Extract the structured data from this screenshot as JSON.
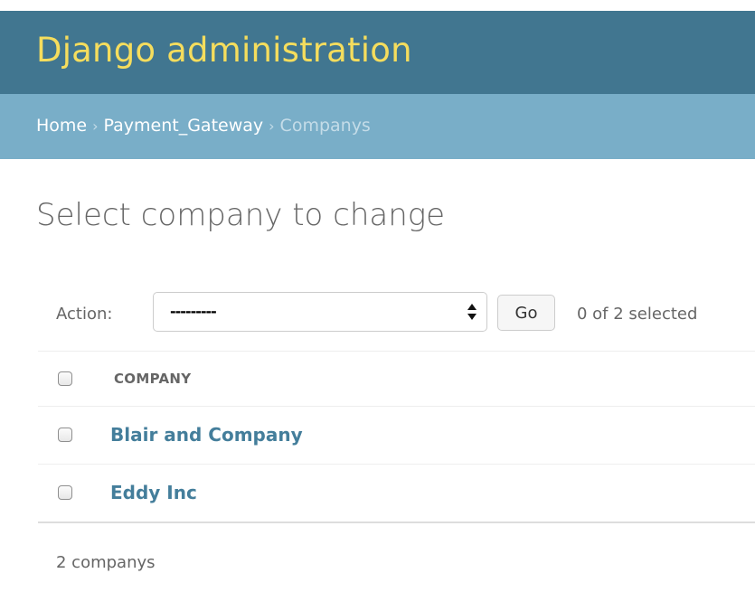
{
  "header": {
    "brand": "Django administration"
  },
  "breadcrumbs": {
    "items": [
      {
        "label": "Home"
      },
      {
        "label": "Payment_Gateway"
      },
      {
        "label": "Companys"
      }
    ],
    "separator": "›"
  },
  "page": {
    "title": "Select company to change"
  },
  "actions": {
    "label": "Action:",
    "selected_option": "---------",
    "go_label": "Go",
    "selected_count": "0 of 2 selected"
  },
  "table": {
    "column_header": "COMPANY",
    "rows": [
      {
        "name": "Blair and Company"
      },
      {
        "name": "Eddy Inc"
      }
    ]
  },
  "paginator": {
    "text": "2 companys"
  },
  "colors": {
    "header_bg": "#417690",
    "brand_text": "#f5dd5d",
    "breadcrumb_bg": "#79aec8",
    "link": "#447e9b"
  }
}
